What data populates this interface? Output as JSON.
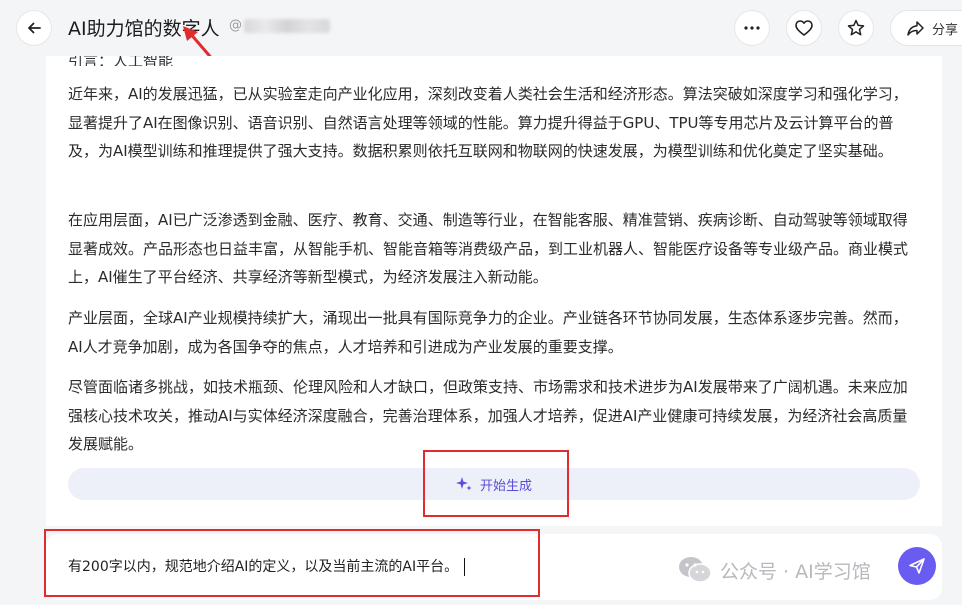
{
  "header": {
    "title": "AI助力馆的数字人",
    "handle": "@",
    "share_label": "分享"
  },
  "icons": {
    "back": "arrow-left-icon",
    "more": "more-horizontal-icon",
    "like": "heart-icon",
    "favorite": "star-icon",
    "share": "share-icon",
    "generate": "sparkle-icon",
    "send": "send-icon",
    "watermark": "wechat-icon"
  },
  "article": {
    "cut_line": "引言：人工智能",
    "paragraphs": [
      "近年来，AI的发展迅猛，已从实验室走向产业化应用，深刻改变着人类社会生活和经济形态。算法突破如深度学习和强化学习，显著提升了AI在图像识别、语音识别、自然语言处理等领域的性能。算力提升得益于GPU、TPU等专用芯片及云计算平台的普及，为AI模型训练和推理提供了强大支持。数据积累则依托互联网和物联网的快速发展，为模型训练和优化奠定了坚实基础。",
      "在应用层面，AI已广泛渗透到金融、医疗、教育、交通、制造等行业，在智能客服、精准营销、疾病诊断、自动驾驶等领域取得显著成效。产品形态也日益丰富，从智能手机、智能音箱等消费级产品，到工业机器人、智能医疗设备等专业级产品。商业模式上，AI催生了平台经济、共享经济等新型模式，为经济发展注入新动能。",
      "产业层面，全球AI产业规模持续扩大，涌现出一批具有国际竞争力的企业。产业链各环节协同发展，生态体系逐步完善。然而，AI人才竞争加剧，成为各国争夺的焦点，人才培养和引进成为产业发展的重要支撑。",
      "尽管面临诸多挑战，如技术瓶颈、伦理风险和人才缺口，但政策支持、市场需求和技术进步为AI发展带来了广阔机遇。未来应加强核心技术攻关，推动AI与实体经济深度融合，完善治理体系，加强人才培养，促进AI产业健康可持续发展，为经济社会高质量发展赋能。"
    ]
  },
  "generate_label": "开始生成",
  "input": {
    "value": "有200字以内，规范地介绍AI的定义，以及当前主流的AI平台。"
  },
  "watermark": "公众号 · AI学习馆",
  "colors": {
    "accent": "#6a5cf0",
    "annotation": "#e02c2c",
    "generate_bar": "#eef0f9"
  }
}
